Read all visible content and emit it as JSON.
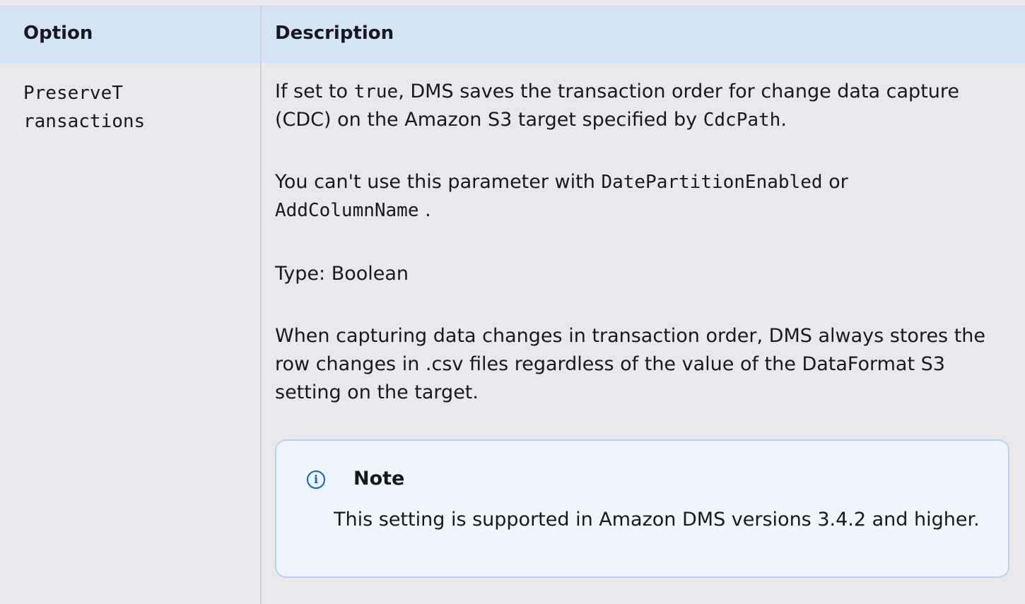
{
  "table": {
    "headers": {
      "option": "Option",
      "description": "Description"
    },
    "row": {
      "option_name_line1": "PreserveT",
      "option_name_line2": "ransactions",
      "p1": {
        "a": "If set to ",
        "code1": "true",
        "b": ", DMS saves the transaction order for change data capture (CDC) on the Amazon S3 target specified by ",
        "code2": "CdcPath",
        "c": "."
      },
      "p2": {
        "a": "You can't use this parameter with ",
        "code1": "DatePartitionEnabled",
        "b": " or ",
        "code2": "AddColumnName",
        "c": " ."
      },
      "p3": "Type: Boolean",
      "p4": "When capturing data changes in transaction order, DMS always stores the row changes in .csv files regardless of the value of the DataFormat S3 setting on the target.",
      "note": {
        "icon": "info-icon",
        "title": "Note",
        "body": "This setting is supported in Amazon DMS versions 3.4.2 and higher."
      }
    }
  },
  "colors": {
    "header_bg": "#d4e4f6",
    "cell_bg": "#e9e9ec",
    "note_bg": "#eff5fc",
    "note_border": "#b6d3f1",
    "accent": "#0b66c8"
  }
}
